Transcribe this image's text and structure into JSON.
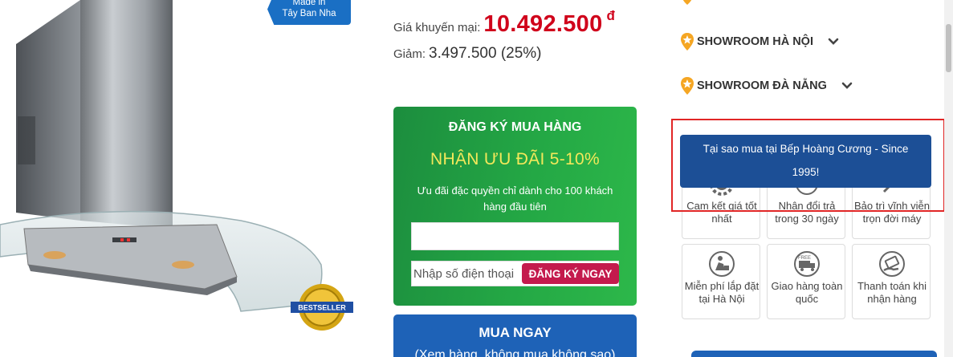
{
  "product": {
    "origin_badge_line1": "Made in",
    "origin_badge_line2": "Tây Ban Nha",
    "bestseller_text": "BESTSELLER"
  },
  "pricing": {
    "promo_label": "Giá khuyến mại:",
    "promo_price": "10.492.500",
    "currency": "đ",
    "discount_label": "Giảm:",
    "discount_value": "3.497.500 (25%)"
  },
  "register": {
    "title": "ĐĂNG KÝ MUA HÀNG",
    "offer": "NHẬN ƯU ĐÃI 5-10%",
    "description": "Ưu đãi đặc quyền chỉ dành cho 100 khách hàng đầu tiên",
    "name_value": "",
    "phone_placeholder": "Nhập số điện thoại",
    "submit_label": "ĐĂNG KÝ NGAY"
  },
  "buy_now": {
    "title": "MUA NGAY",
    "subtitle": "(Xem hàng, không mua không sao)"
  },
  "showrooms": [
    {
      "label": "SHOWROOM HÀ NỘI"
    },
    {
      "label": "SHOWROOM ĐÀ NẴNG"
    }
  ],
  "why_buy": {
    "title": "Tại sao mua tại Bếp Hoàng Cương - Since 1995!"
  },
  "benefits": [
    {
      "label": "Cam kết giá tốt nhất",
      "icon": "gear-check-icon"
    },
    {
      "label": "Nhận đổi trả trong 30 ngày",
      "icon": "return-30-icon"
    },
    {
      "label": "Bảo trì vĩnh viễn trọn đời máy",
      "icon": "maintenance-icon"
    },
    {
      "label": "Miễn phí lắp đặt tại Hà Nội",
      "icon": "installation-icon"
    },
    {
      "label": "Giao hàng toàn quốc",
      "icon": "free-delivery-icon"
    },
    {
      "label": "Thanh toán khi nhận hàng",
      "icon": "cash-on-delivery-icon"
    }
  ],
  "colors": {
    "price_red": "#d0021b",
    "register_green": "#24a845",
    "offer_yellow": "#f3e85a",
    "register_button": "#c41a4d",
    "buy_blue": "#1e62b7",
    "why_blue": "#1c4f96",
    "pin_orange": "#f5a623",
    "highlight_red": "#e12626"
  }
}
